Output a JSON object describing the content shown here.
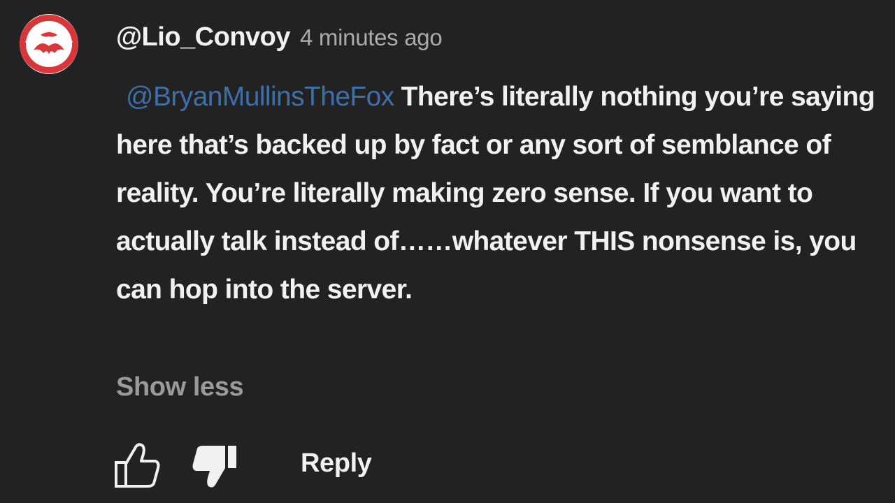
{
  "comment": {
    "author": "@Lio_Convoy",
    "timestamp": "4 minutes ago",
    "mention": "@BryanMullinsTheFox",
    "text": "There’s literally nothing you’re saying here that’s backed up by fact or any sort of semblance of reality. You’re literally making zero sense. If you want to actually talk instead of……whatever THIS nonsense is, you can hop into the server.",
    "show_less_label": "Show less",
    "reply_label": "Reply",
    "avatar_icon": "red-white-emblem-avatar",
    "like_icon": "thumbs-up-outline-icon",
    "dislike_icon": "thumbs-down-filled-icon"
  },
  "colors": {
    "background": "#222222",
    "mention": "#3e6fa8",
    "muted": "#aaaaaa",
    "avatar_red": "#d9363a"
  }
}
